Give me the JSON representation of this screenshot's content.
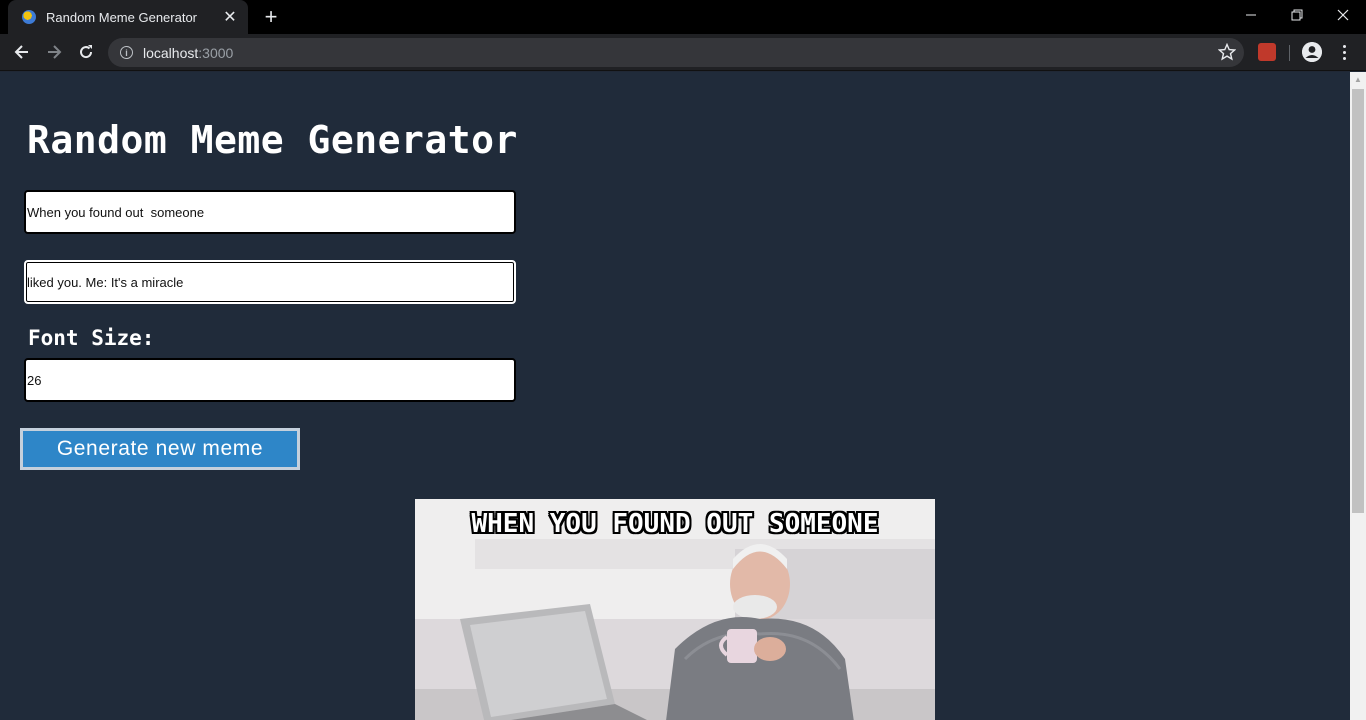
{
  "browser": {
    "tab_title": "Random Meme Generator",
    "url_host": "localhost",
    "url_port": ":3000"
  },
  "page": {
    "title": "Random Meme Generator",
    "top_text_value": "When you found out  someone",
    "bottom_text_value": "liked you. Me: It's a miracle",
    "font_size_label": "Font Size:",
    "font_size_value": "26",
    "generate_button_label": "Generate new meme"
  },
  "meme": {
    "top_caption": "When you found out  someone",
    "font_size": 26
  },
  "icons": [
    "favicon-icon",
    "close-icon",
    "plus-icon",
    "minimize-icon",
    "restore-icon",
    "window-close-icon",
    "back-arrow-icon",
    "forward-arrow-icon",
    "reload-icon",
    "info-icon",
    "star-icon",
    "extension-icon",
    "profile-icon",
    "menu-dots-icon"
  ],
  "colors": {
    "page_background": "#202b3a",
    "button_background": "#2e86c8",
    "chrome_background": "#202124"
  }
}
